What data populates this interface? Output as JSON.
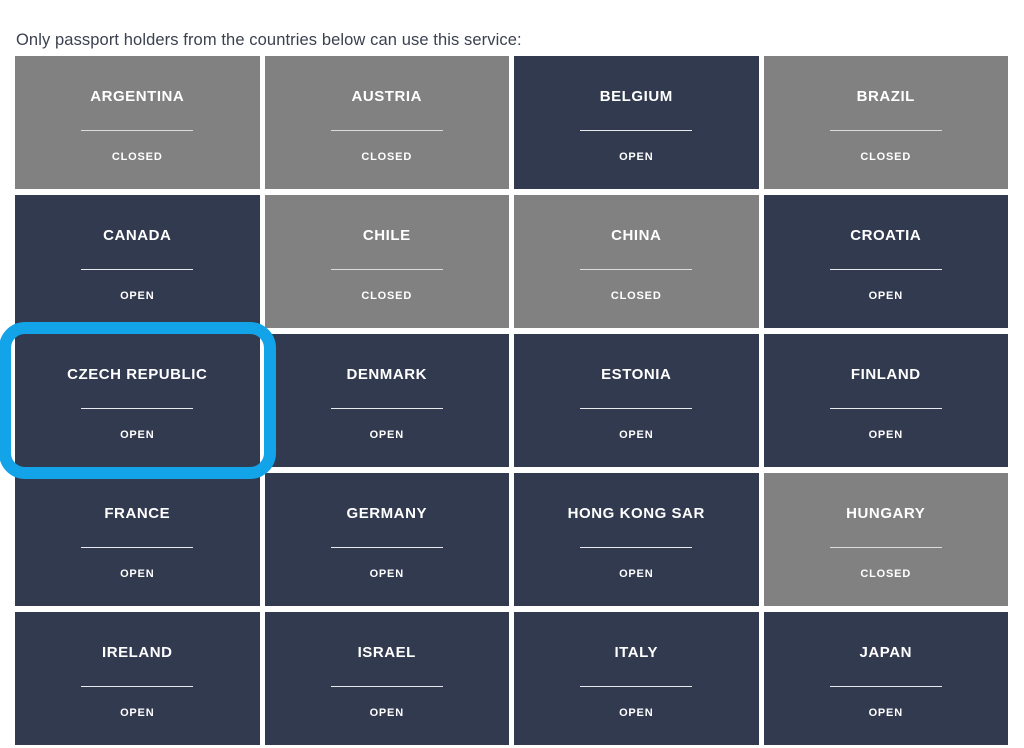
{
  "intro": {
    "text": "Only passport holders from the countries below can use this service:"
  },
  "legend": {
    "open_label": "OPEN",
    "closed_label": "CLOSED"
  },
  "colors": {
    "open_background": "#323a50",
    "closed_background": "#818181",
    "highlight_ring": "#12a3e8",
    "tile_text": "#ffffff",
    "intro_text": "#3b4150",
    "page_background": "#ffffff"
  },
  "grid": {
    "columns": 4,
    "tiles": [
      {
        "name": "ARGENTINA",
        "status": "CLOSED",
        "highlighted": false
      },
      {
        "name": "AUSTRIA",
        "status": "CLOSED",
        "highlighted": false
      },
      {
        "name": "BELGIUM",
        "status": "OPEN",
        "highlighted": false
      },
      {
        "name": "BRAZIL",
        "status": "CLOSED",
        "highlighted": false
      },
      {
        "name": "CANADA",
        "status": "OPEN",
        "highlighted": false
      },
      {
        "name": "CHILE",
        "status": "CLOSED",
        "highlighted": false
      },
      {
        "name": "CHINA",
        "status": "CLOSED",
        "highlighted": false
      },
      {
        "name": "CROATIA",
        "status": "OPEN",
        "highlighted": false
      },
      {
        "name": "CZECH REPUBLIC",
        "status": "OPEN",
        "highlighted": true
      },
      {
        "name": "DENMARK",
        "status": "OPEN",
        "highlighted": false
      },
      {
        "name": "ESTONIA",
        "status": "OPEN",
        "highlighted": false
      },
      {
        "name": "FINLAND",
        "status": "OPEN",
        "highlighted": false
      },
      {
        "name": "FRANCE",
        "status": "OPEN",
        "highlighted": false
      },
      {
        "name": "GERMANY",
        "status": "OPEN",
        "highlighted": false
      },
      {
        "name": "HONG KONG SAR",
        "status": "OPEN",
        "highlighted": false
      },
      {
        "name": "HUNGARY",
        "status": "CLOSED",
        "highlighted": false
      },
      {
        "name": "IRELAND",
        "status": "OPEN",
        "highlighted": false
      },
      {
        "name": "ISRAEL",
        "status": "OPEN",
        "highlighted": false
      },
      {
        "name": "ITALY",
        "status": "OPEN",
        "highlighted": false
      },
      {
        "name": "JAPAN",
        "status": "OPEN",
        "highlighted": false
      }
    ]
  }
}
